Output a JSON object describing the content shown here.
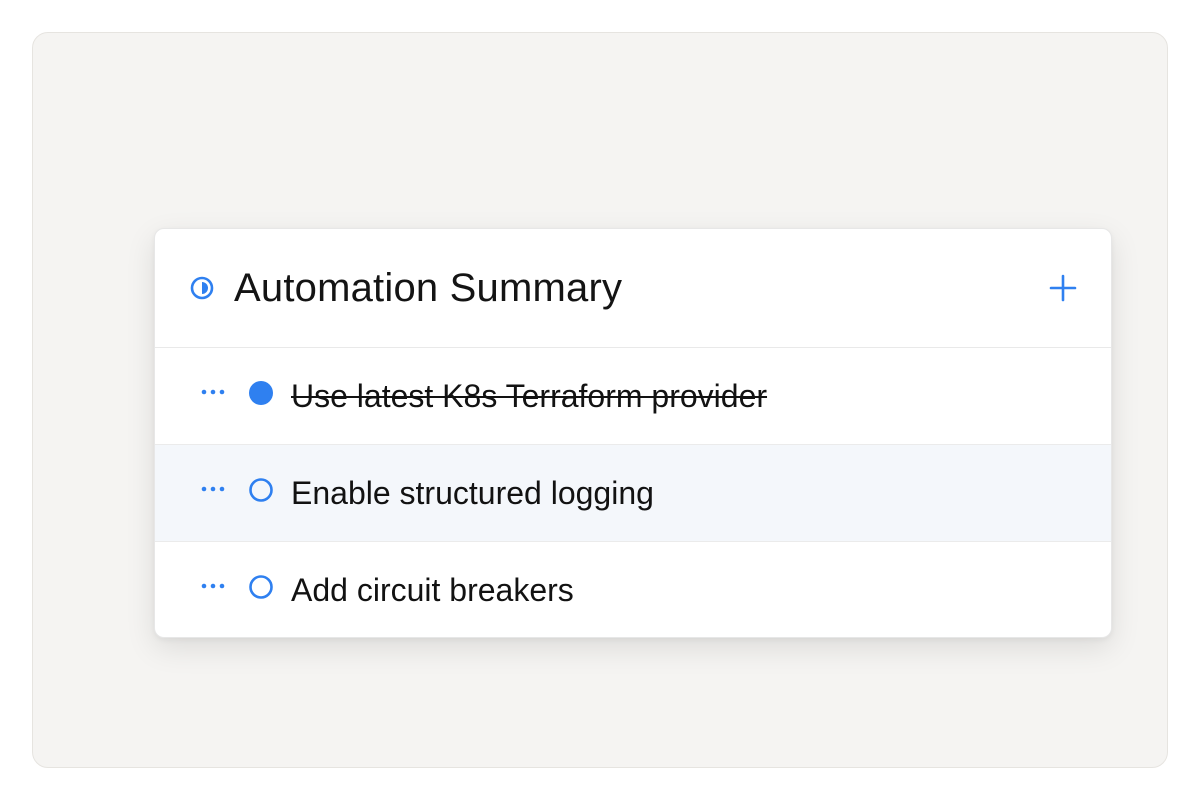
{
  "colors": {
    "accent": "#2f80f0",
    "canvas_bg": "#f5f4f2",
    "row_highlight": "#f4f7fb"
  },
  "card": {
    "title": "Automation Summary",
    "title_icon": "half-circle-status-icon",
    "add_icon": "plus-icon"
  },
  "items": [
    {
      "label": "Use latest K8s Terraform provider",
      "done": true,
      "highlighted": false
    },
    {
      "label": "Enable structured logging",
      "done": false,
      "highlighted": true
    },
    {
      "label": "Add circuit breakers",
      "done": false,
      "highlighted": false
    }
  ]
}
